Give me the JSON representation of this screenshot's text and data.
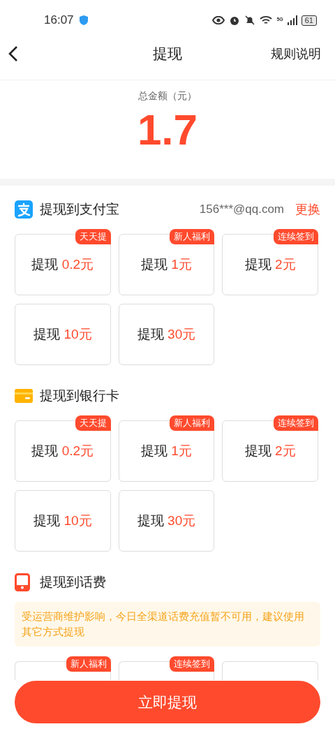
{
  "status_bar": {
    "time": "16:07",
    "battery": "61",
    "network": "5G"
  },
  "header": {
    "title": "提现",
    "rules_link": "规则说明"
  },
  "balance": {
    "label": "总金额（元）",
    "amount": "1.7"
  },
  "sections": [
    {
      "kind": "alipay",
      "title": "提现到支付宝",
      "account": "156***@qq.com",
      "change_link": "更换",
      "options": [
        {
          "label": "提现",
          "amount": "0.2元",
          "badge": "天天提",
          "selected": false
        },
        {
          "label": "提现",
          "amount": "1元",
          "badge": "新人福利",
          "selected": false
        },
        {
          "label": "提现",
          "amount": "2元",
          "badge": "连续签到",
          "selected": false
        },
        {
          "label": "提现",
          "amount": "10元",
          "selected": false
        },
        {
          "label": "提现",
          "amount": "30元",
          "selected": false
        }
      ]
    },
    {
      "kind": "bank",
      "title": "提现到银行卡",
      "options": [
        {
          "label": "提现",
          "amount": "0.2元",
          "badge": "天天提",
          "selected": false
        },
        {
          "label": "提现",
          "amount": "1元",
          "badge": "新人福利",
          "selected": false
        },
        {
          "label": "提现",
          "amount": "2元",
          "badge": "连续签到",
          "selected": false
        },
        {
          "label": "提现",
          "amount": "10元",
          "selected": false
        },
        {
          "label": "提现",
          "amount": "30元",
          "selected": false
        }
      ]
    },
    {
      "kind": "phone",
      "title": "提现到话费",
      "notice": "受运营商维护影响，今日全渠道话费充值暂不可用，建议使用其它方式提现",
      "options": [
        {
          "badge": "新人福利",
          "selected": false
        },
        {
          "badge": "连续签到",
          "selected": false
        },
        {
          "selected": false
        }
      ]
    }
  ],
  "submit_button": "立即提现"
}
